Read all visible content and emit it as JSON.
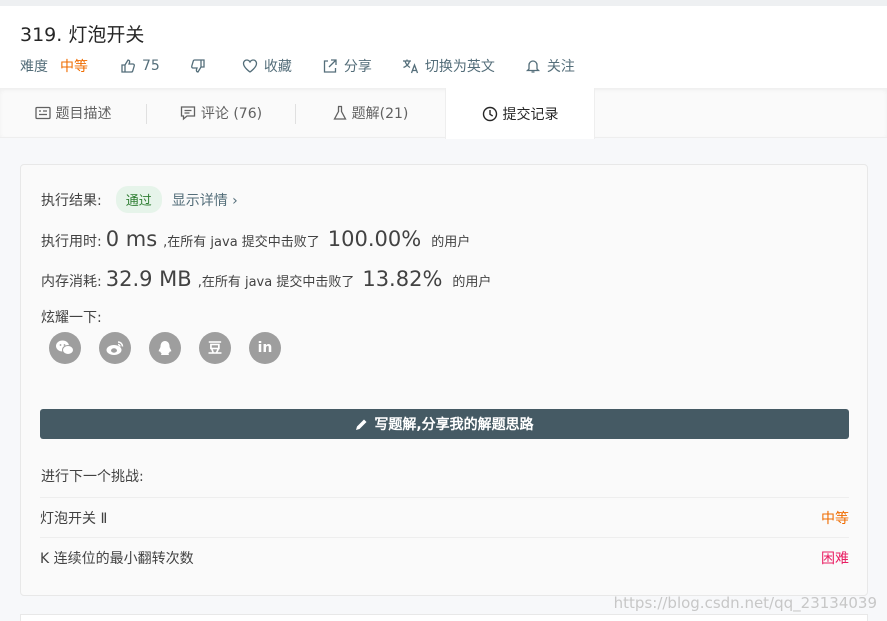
{
  "problem": {
    "title": "319. 灯泡开关",
    "difficulty_label": "难度",
    "difficulty": "中等",
    "likes": "75",
    "favorite_label": "收藏",
    "share_label": "分享",
    "switch_lang_label": "切换为英文",
    "follow_label": "关注"
  },
  "tabs": [
    {
      "label": "题目描述",
      "icon": "description-icon"
    },
    {
      "label": "评论 (76)",
      "icon": "comment-icon"
    },
    {
      "label": "题解(21)",
      "icon": "flask-icon"
    },
    {
      "label": "提交记录",
      "icon": "clock-icon"
    }
  ],
  "result": {
    "label": "执行结果:",
    "status": "通过",
    "detail_link": "显示详情 ›",
    "time_label": "执行用时:",
    "time_value": "0 ms",
    "time_mid": ",在所有 java 提交中击败了",
    "time_percent": "100.00%",
    "time_suffix": "的用户",
    "mem_label": "内存消耗:",
    "mem_value": "32.9 MB",
    "mem_mid": ",在所有 java 提交中击败了",
    "mem_percent": "13.82%",
    "mem_suffix": "的用户",
    "share_label": "炫耀一下:",
    "social_icons": [
      "wechat-icon",
      "weibo-icon",
      "qq-icon",
      "douban-icon",
      "linkedin-icon"
    ],
    "douban_glyph": "豆",
    "linkedin_glyph": "in"
  },
  "write_solution_button": "写题解,分享我的解题思路",
  "next_challenge": {
    "label": "进行下一个挑战:",
    "items": [
      {
        "name": "灯泡开关 Ⅱ",
        "difficulty": "中等"
      },
      {
        "name": "K 连续位的最小翻转次数",
        "difficulty": "困难"
      }
    ]
  },
  "watermark": "https://blog.csdn.net/qq_23134039",
  "colors": {
    "medium": "#ef6c00",
    "hard": "#e91e63",
    "accepted_bg": "#e6f4ea",
    "accepted_text": "#2e7d32",
    "button": "#455a64"
  }
}
